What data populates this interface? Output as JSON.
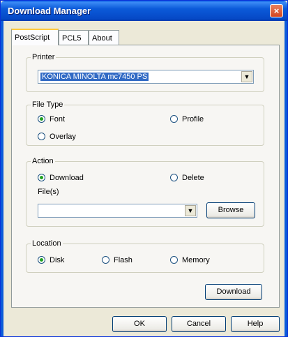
{
  "window": {
    "title": "Download Manager",
    "close_icon": "×"
  },
  "tabs": [
    {
      "label": "PostScript",
      "active": true
    },
    {
      "label": "PCL5",
      "active": false
    },
    {
      "label": "About",
      "active": false
    }
  ],
  "printer": {
    "legend": "Printer",
    "selected": "KONICA MINOLTA mc7450 PS"
  },
  "file_type": {
    "legend": "File Type",
    "options": [
      {
        "label": "Font",
        "checked": true
      },
      {
        "label": "Profile",
        "checked": false
      },
      {
        "label": "Overlay",
        "checked": false
      }
    ]
  },
  "action": {
    "legend": "Action",
    "options": [
      {
        "label": "Download",
        "checked": true
      },
      {
        "label": "Delete",
        "checked": false
      }
    ],
    "files_label": "File(s)",
    "files_value": "",
    "browse_label": "Browse"
  },
  "location": {
    "legend": "Location",
    "options": [
      {
        "label": "Disk",
        "checked": true
      },
      {
        "label": "Flash",
        "checked": false
      },
      {
        "label": "Memory",
        "checked": false
      }
    ]
  },
  "download_button": "Download",
  "footer": {
    "ok": "OK",
    "cancel": "Cancel",
    "help": "Help"
  }
}
